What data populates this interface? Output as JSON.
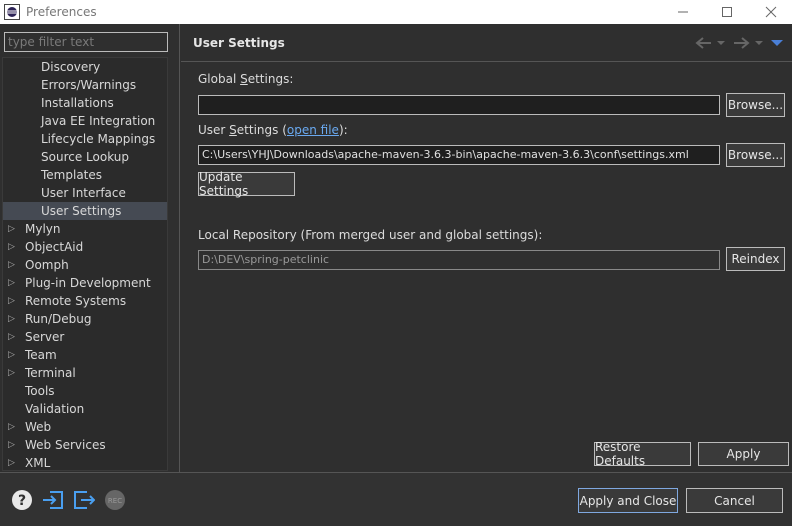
{
  "window": {
    "title": "Preferences"
  },
  "filter": {
    "placeholder": "type filter text"
  },
  "tree": {
    "children": [
      "Discovery",
      "Errors/Warnings",
      "Installations",
      "Java EE Integration",
      "Lifecycle Mappings",
      "Source Lookup",
      "Templates",
      "User Interface",
      "User Settings"
    ],
    "selected": "User Settings",
    "top_items": [
      {
        "label": "Mylyn",
        "expandable": true
      },
      {
        "label": "ObjectAid",
        "expandable": true
      },
      {
        "label": "Oomph",
        "expandable": true
      },
      {
        "label": "Plug-in Development",
        "expandable": true
      },
      {
        "label": "Remote Systems",
        "expandable": true
      },
      {
        "label": "Run/Debug",
        "expandable": true
      },
      {
        "label": "Server",
        "expandable": true
      },
      {
        "label": "Team",
        "expandable": true
      },
      {
        "label": "Terminal",
        "expandable": true
      },
      {
        "label": "Tools",
        "expandable": false
      },
      {
        "label": "Validation",
        "expandable": false
      },
      {
        "label": "Web",
        "expandable": true
      },
      {
        "label": "Web Services",
        "expandable": true
      },
      {
        "label": "XML",
        "expandable": true
      }
    ]
  },
  "page": {
    "title": "User Settings",
    "global_settings_label_pre": "Global ",
    "global_settings_label_mnemonic": "S",
    "global_settings_label_post": "ettings:",
    "global_settings_value": "",
    "browse_label": "Browse...",
    "user_settings_label_pre": "User ",
    "user_settings_label_mnemonic": "S",
    "user_settings_label_post": "ettings (",
    "open_file_link": "open file",
    "user_settings_label_end": "):",
    "user_settings_value": "C:\\Users\\YHJ\\Downloads\\apache-maven-3.6.3-bin\\apache-maven-3.6.3\\conf\\settings.xml",
    "update_settings_label": "Update Settings",
    "local_repo_label": "Local Repository (From merged user and global settings):",
    "local_repo_value": "D:\\DEV\\spring-petclinic",
    "reindex_label": "Reindex",
    "restore_defaults_label": "Restore Defaults",
    "apply_label": "Apply"
  },
  "bottom": {
    "apply_close_label": "Apply and Close",
    "cancel_label": "Cancel",
    "icons": [
      "help-icon",
      "import-icon",
      "export-icon",
      "record-icon"
    ]
  },
  "colors": {
    "background": "#2f2f2f",
    "selection": "#454a53",
    "link": "#6aa9f0",
    "accent_blue": "#4a7fd6"
  }
}
